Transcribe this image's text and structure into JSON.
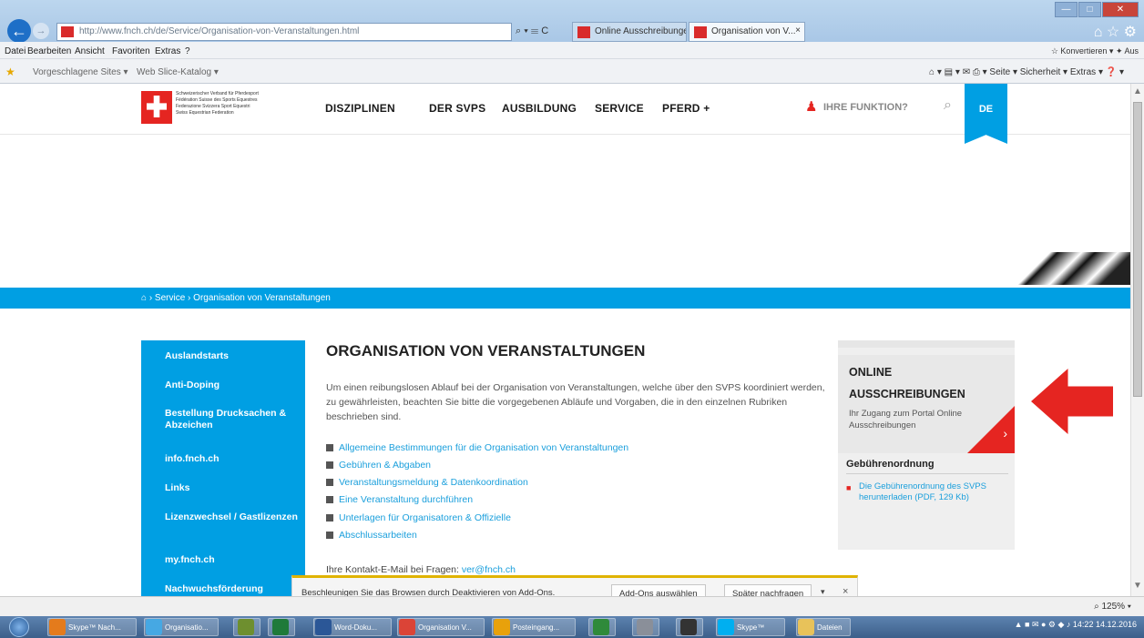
{
  "browser": {
    "address": "http://www.fnch.ch/de/Service/Organisation-von-Veranstaltungen.html",
    "address_controls": "⌕ ▾ ☰ C",
    "tabs": [
      {
        "label": "Online Ausschreibungen"
      },
      {
        "label": "Organisation von V..."
      }
    ],
    "tab_close": "×",
    "window_controls": [
      "—",
      "□",
      "✕"
    ],
    "nav_icons": "⌂ ☆ ⚙",
    "menu": [
      "Datei",
      "Bearbeiten",
      "Ansicht",
      "Favoriten",
      "Extras",
      "?"
    ],
    "menu_right": "☆ Konvertieren ▾  ✦ Aus",
    "favorites": [
      "Vorgeschlagene Sites ▾",
      "Web Slice-Katalog ▾"
    ],
    "command_bar": "⌂ ▾  ▤ ▾  ✉  ⎙ ▾  Seite ▾  Sicherheit ▾  Extras ▾  ❓ ▾",
    "zoom": "⌕ 125%  ▾"
  },
  "site": {
    "logo_lines": [
      "Schweizerischer Verband für Pferdesport",
      "Fédération Suisse des Sports Equestres",
      "Federazione Svizzera Sport Equestri",
      "Swiss Equestrian Federation"
    ],
    "nav": [
      "DISZIPLINEN",
      "DER SVPS",
      "AUSBILDUNG",
      "SERVICE",
      "PFERD +"
    ],
    "user_icon": "♟",
    "user_label": "IHRE FUNKTION?",
    "search_icon": "⌕",
    "language": "DE",
    "breadcrumb_home": "⌂",
    "breadcrumb": "› Service › Organisation von Veranstaltungen",
    "sidebar": [
      "Auslandstarts",
      "Anti-Doping",
      "Bestellung Drucksachen & Abzeichen",
      "info.fnch.ch",
      "Links",
      "Lizenzwechsel / Gastlizenzen",
      "my.fnch.ch",
      "Nachwuchsförderung"
    ],
    "title": "ORGANISATION VON VERANSTALTUNGEN",
    "intro": "Um einen reibungslosen Ablauf bei der Organisation von Veranstaltungen, welche über den SVPS koordiniert werden, zu gewährleisten, beachten Sie bitte die vorgegebenen Abläufe und Vorgaben, die in den einzelnen Rubriken beschrieben sind.",
    "links": [
      "Allgemeine Bestimmungen für die Organisation von Veranstaltungen",
      "Gebühren & Abgaben",
      "Veranstaltungsmeldung & Datenkoordination",
      "Eine Veranstaltung durchführen",
      "Unterlagen für Organisatoren & Offizielle",
      "Abschlussarbeiten"
    ],
    "contact_label": "Ihre Kontakt-E-Mail bei Fragen:",
    "contact_email": "ver@fnch.ch",
    "online_title_1": "ONLINE",
    "online_title_2": "AUSSCHREIBUNGEN",
    "online_sub": "Ihr Zugang zum Portal Online Ausschreibungen",
    "online_arrow": "›",
    "geb_title": "Gebührenordnung",
    "geb_icon": "■",
    "geb_link": "Die Gebührenordnung des SVPS herunterladen (PDF, 129 Kb)"
  },
  "notification": {
    "text": "Beschleunigen Sie das Browsen durch Deaktivieren von Add-Ons.",
    "button_primary": "Add-Ons auswählen",
    "button_secondary": "Später nachfragen",
    "dropdown": "▾",
    "close": "×"
  },
  "taskbar": {
    "items": [
      "Skype™ Nach...",
      "Organisatio...",
      "",
      "",
      "Word-Doku...",
      "Organisation V...",
      "Posteingang...",
      "",
      "",
      "",
      "Skype™",
      "Dateien"
    ],
    "tray": "▲ ■ ✉ ● ⚙ ◆ ♪  14:22  14.12.2016"
  },
  "colors": {
    "accent": "#009fe3",
    "brand_red": "#e52521"
  }
}
